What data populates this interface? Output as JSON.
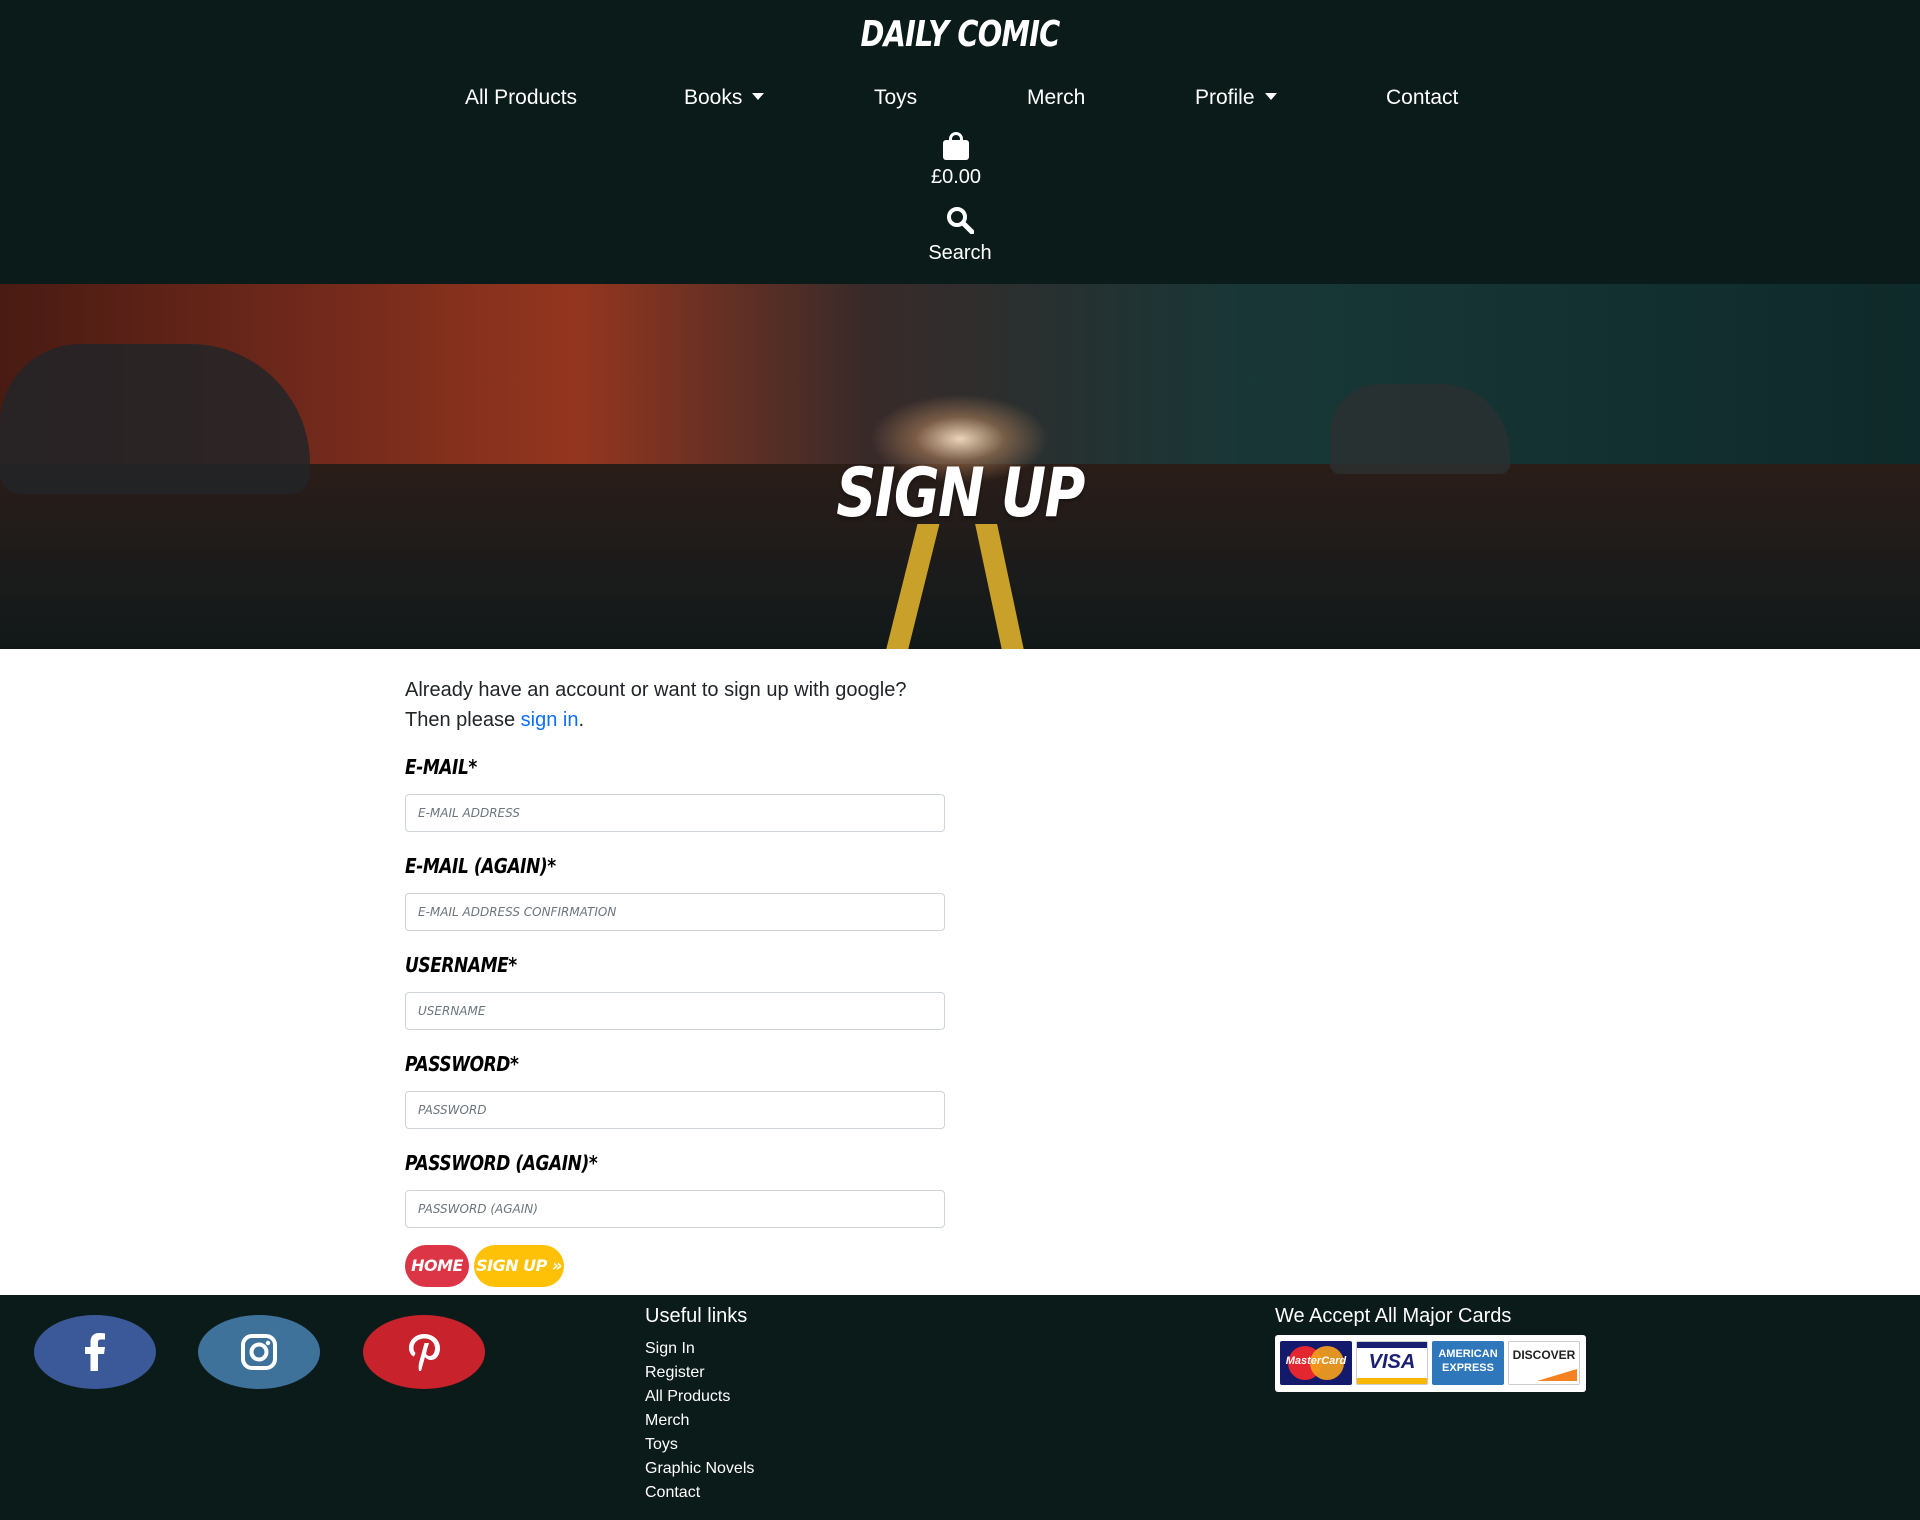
{
  "brand": "DAILY COMIC",
  "nav": {
    "items": [
      {
        "label": "All Products",
        "dropdown": false
      },
      {
        "label": "Books",
        "dropdown": true
      },
      {
        "label": "Toys",
        "dropdown": false
      },
      {
        "label": "Merch",
        "dropdown": false
      },
      {
        "label": "Profile",
        "dropdown": true
      },
      {
        "label": "Contact",
        "dropdown": false
      }
    ],
    "bag_icon": "shopping-bag-icon",
    "bag_total": "£0.00",
    "search_icon": "search-icon",
    "search_label": "Search"
  },
  "hero": {
    "title": "SIGN UP"
  },
  "form": {
    "intro_line1": "Already have an account or want to sign up with google?",
    "intro_line2_prefix": "Then please ",
    "intro_link": "sign in",
    "intro_line2_suffix": ".",
    "fields": {
      "email": {
        "label": "E-MAIL*",
        "placeholder": "E-MAIL ADDRESS",
        "value": ""
      },
      "email2": {
        "label": "E-MAIL (AGAIN)*",
        "placeholder": "E-MAIL ADDRESS CONFIRMATION",
        "value": ""
      },
      "username": {
        "label": "USERNAME*",
        "placeholder": "USERNAME",
        "value": ""
      },
      "password": {
        "label": "PASSWORD*",
        "placeholder": "PASSWORD",
        "value": ""
      },
      "password2": {
        "label": "PASSWORD (AGAIN)*",
        "placeholder": "PASSWORD (AGAIN)",
        "value": ""
      }
    },
    "home_button": "HOME",
    "signup_button": "SIGN UP »"
  },
  "footer": {
    "social": [
      {
        "icon": "facebook-icon",
        "color": "#3b5998"
      },
      {
        "icon": "instagram-icon",
        "color": "#3f729b"
      },
      {
        "icon": "pinterest-icon",
        "color": "#c8232c"
      }
    ],
    "links_title": "Useful links",
    "links": [
      "Sign In",
      "Register",
      "All Products",
      "Merch",
      "Toys",
      "Graphic Novels",
      "Contact"
    ],
    "cards_title": "We Accept All Major Cards",
    "cards": [
      {
        "name": "MasterCard",
        "icon": "mastercard-icon"
      },
      {
        "name": "VISA",
        "icon": "visa-icon"
      },
      {
        "name": "AMERICAN EXPRESS",
        "icon": "amex-icon"
      },
      {
        "name": "DISCOVER",
        "icon": "discover-icon"
      }
    ]
  },
  "colors": {
    "header_bg": "#0b1b19",
    "link": "#0d6efd",
    "home_button": "#dc3545",
    "signup_button": "#ffc107"
  }
}
